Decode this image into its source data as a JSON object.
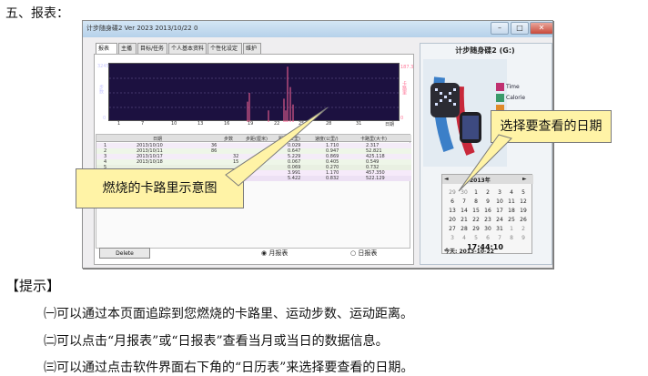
{
  "section_heading": "五、报表：",
  "window": {
    "title": "计步随身碟2 Ver 2023 2013/10/22 0",
    "tabs": [
      "报表",
      "主播",
      "目标/任务",
      "个人基本资料",
      "个性化设定",
      "维护"
    ]
  },
  "chart": {
    "y_max": "3245",
    "y_min": "0",
    "y_label": "步数",
    "right_max": "187.3",
    "right_min": "0",
    "right_label": "卡路里",
    "x_ticks": [
      "1",
      "7",
      "10",
      "13",
      "16",
      "19",
      "22",
      "25",
      "28",
      "31"
    ],
    "x_label": "日期",
    "colors": {
      "background": "#1c1140",
      "bars": "#ff6699"
    }
  },
  "table": {
    "headers": [
      "日期",
      "步数",
      "步距(厘米)",
      "距离(公里)",
      "速度(公里/)",
      "卡路里(大卡)"
    ],
    "rows": [
      [
        "1",
        "2013/10/10",
        "36",
        "",
        "0.029",
        "1.710",
        "2.317"
      ],
      [
        "2",
        "2013/10/11",
        "86",
        "",
        "0.647",
        "0.947",
        "52.821"
      ],
      [
        "3",
        "2013/10/17",
        "",
        "32",
        "5.229",
        "0.869",
        "425.118"
      ],
      [
        "4",
        "2013/10/18",
        "",
        "15",
        "0.067",
        "0.405",
        "0.549"
      ],
      [
        "5",
        "",
        "",
        "",
        "0.069",
        "0.270",
        "0.732"
      ],
      [
        "6",
        "",
        "",
        "",
        "3.991",
        "1.170",
        "457.350"
      ],
      [
        "7",
        "",
        "",
        "",
        "5.422",
        "0.832",
        "522.129"
      ]
    ]
  },
  "delete_button": "Delete",
  "radios": {
    "monthly": "月报表",
    "daily": "日报表"
  },
  "device": {
    "title": "计步随身碟2 (G:)",
    "features": [
      "Time",
      "Calorie"
    ],
    "colors": {
      "time": "#c03070",
      "calorie": "#3a9a6a",
      "orange": "#e08a2a",
      "blue": "#3b6fb6"
    }
  },
  "calendar": {
    "month_title": "2013年",
    "prev": "◄",
    "next": "►",
    "weeks": [
      [
        "29",
        "30",
        "1",
        "2",
        "3",
        "4",
        "5"
      ],
      [
        "6",
        "7",
        "8",
        "9",
        "10",
        "11",
        "12"
      ],
      [
        "13",
        "14",
        "15",
        "16",
        "17",
        "18",
        "19"
      ],
      [
        "20",
        "21",
        "22",
        "23",
        "24",
        "25",
        "26"
      ],
      [
        "27",
        "28",
        "29",
        "30",
        "31",
        "1",
        "2"
      ],
      [
        "3",
        "4",
        "5",
        "6",
        "7",
        "8",
        "9"
      ]
    ],
    "today_label": "今天: 2013-10-22"
  },
  "clock": "17:44:10",
  "callouts": {
    "calorie": "燃烧的卡路里示意图",
    "calendar": "选择要查看的日期"
  },
  "hints": {
    "label": "【提示】",
    "items": [
      "㈠可以通过本页面追踪到您燃烧的卡路里、运动步数、运动距离。",
      "㈡可以点击“月报表”或“日报表”查看当月或当日的数据信息。",
      "㈢可以通过点击软件界面右下角的“日历表”来选择要查看的日期。"
    ]
  }
}
